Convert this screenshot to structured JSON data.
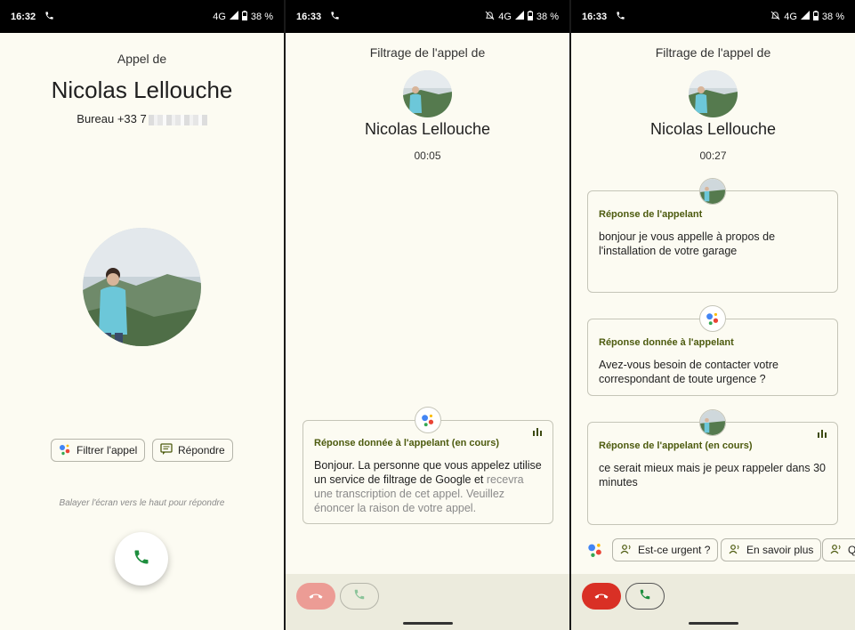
{
  "status": {
    "p1": {
      "time": "16:32",
      "network": "4G",
      "battery": "38 %"
    },
    "p2": {
      "time": "16:33",
      "network": "4G",
      "battery": "38 %"
    },
    "p3": {
      "time": "16:33",
      "network": "4G",
      "battery": "38 %"
    }
  },
  "screen1": {
    "header": "Appel de",
    "caller_name": "Nicolas Lellouche",
    "number": "Bureau +33 7",
    "filter_button": "Filtrer l'appel",
    "reply_button": "Répondre",
    "hint": "Balayer l'écran vers le haut pour répondre"
  },
  "screen2": {
    "header": "Filtrage de l'appel de",
    "caller_name": "Nicolas Lellouche",
    "timer": "00:05",
    "card_title": "Réponse donnée à l'appelant (en cours)",
    "card_text_dark": "Bonjour. La personne que vous appelez utilise un service de filtrage de Google et",
    "card_text_faded": "recevra une transcription de cet appel. Veuillez énoncer la raison de votre appel."
  },
  "screen3": {
    "header": "Filtrage de l'appel de",
    "caller_name": "Nicolas Lellouche",
    "timer": "00:27",
    "card1_title": "Réponse de l'appelant",
    "card1_text": "bonjour je vous appelle à propos de l'installation de votre garage",
    "card2_title": "Réponse donnée à l'appelant",
    "card2_text": "Avez-vous besoin de contacter votre correspondant de toute urgence ?",
    "card3_title": "Réponse de l'appelant (en cours)",
    "card3_text": "ce serait mieux mais je peux rappeler dans 30 minutes",
    "chips": [
      "Est-ce urgent ?",
      "En savoir plus",
      "Qu"
    ]
  },
  "colors": {
    "background": "#fcfbf2",
    "accent_olive": "#4d5b0f",
    "decline_red": "#d93025",
    "decline_red_faded": "#ec9c95",
    "answer_green": "#1e8e3e",
    "bottom_bar": "#ecebdd"
  },
  "icons": [
    "phone-icon",
    "signal-icon",
    "battery-icon",
    "mute-icon",
    "google-assistant-icon",
    "chat-icon",
    "hangup-icon",
    "person-speak-icon",
    "audio-bars-icon"
  ]
}
